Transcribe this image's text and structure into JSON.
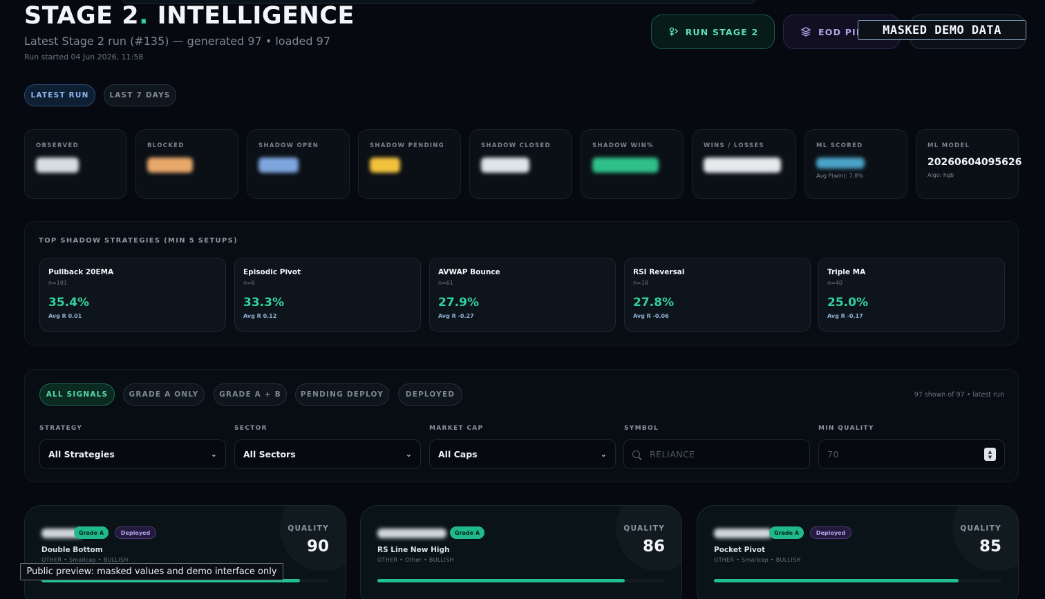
{
  "header": {
    "title_main": "STAGE 2",
    "title_dot": ".",
    "title_rest": " INTELLIGENCE",
    "subtitle": "Latest Stage 2 run (#135) — generated 97 • loaded 97",
    "run_started": "Run started 04 Jun 2026, 11:58"
  },
  "actions": {
    "run_stage2": "RUN STAGE 2",
    "eod_pipeline": "EOD PIPE",
    "masked_banner": "MASKED DEMO DATA"
  },
  "range_tabs": [
    "LATEST RUN",
    "LAST 7 DAYS"
  ],
  "stats": {
    "observed": "OBSERVED",
    "blocked": "BLOCKED",
    "shadow_open": "SHADOW OPEN",
    "shadow_pending": "SHADOW PENDING",
    "shadow_closed": "SHADOW CLOSED",
    "shadow_win": "SHADOW WIN%",
    "wins_losses": "WINS / LOSSES",
    "ml_scored": "ML SCORED",
    "ml_scored_sub": "Avg P(win): 7.8%",
    "ml_model": "ML MODEL",
    "ml_model_value": "20260604095626",
    "ml_model_sub": "Algo: hgb"
  },
  "top_strategies": {
    "title": "TOP SHADOW STRATEGIES (MIN 5 SETUPS)",
    "items": [
      {
        "name": "Pullback 20EMA",
        "n": "n=181",
        "pct": "35.4%",
        "avg": "Avg R 0.01"
      },
      {
        "name": "Episodic Pivot",
        "n": "n=6",
        "pct": "33.3%",
        "avg": "Avg R 0.12"
      },
      {
        "name": "AVWAP Bounce",
        "n": "n=61",
        "pct": "27.9%",
        "avg": "Avg R -0.27"
      },
      {
        "name": "RSI Reversal",
        "n": "n=18",
        "pct": "27.8%",
        "avg": "Avg R -0.06"
      },
      {
        "name": "Triple MA",
        "n": "n=40",
        "pct": "25.0%",
        "avg": "Avg R -0.17"
      }
    ]
  },
  "filters": {
    "pills": [
      "ALL SIGNALS",
      "GRADE A ONLY",
      "GRADE A + B",
      "PENDING DEPLOY",
      "DEPLOYED"
    ],
    "shown": "97 shown of 97 • latest run",
    "strategy_label": "STRATEGY",
    "strategy_value": "All Strategies",
    "sector_label": "SECTOR",
    "sector_value": "All Sectors",
    "cap_label": "MARKET CAP",
    "cap_value": "All Caps",
    "symbol_label": "SYMBOL",
    "symbol_placeholder": "RELIANCE",
    "quality_label": "MIN QUALITY",
    "quality_placeholder": "70"
  },
  "signals": [
    {
      "grade": "Grade A",
      "deployed": "Deployed",
      "name": "Double Bottom",
      "meta": "OTHER • Smallcap • BULLISH",
      "quality_label": "QUALITY",
      "quality": "90",
      "quality_fraction": 0.9
    },
    {
      "grade": "Grade A",
      "deployed": "",
      "name": "RS Line New High",
      "meta": "OTHER • Other • BULLISH",
      "quality_label": "QUALITY",
      "quality": "86",
      "quality_fraction": 0.86
    },
    {
      "grade": "Grade A",
      "deployed": "Deployed",
      "name": "Pocket Pivot",
      "meta": "OTHER • Smallcap • BULLISH",
      "quality_label": "QUALITY",
      "quality": "85",
      "quality_fraction": 0.85
    }
  ],
  "preview_note": "Public preview: masked values and demo interface only",
  "colors": {
    "accent": "#2fcf95",
    "background": "#060a10",
    "deployed": "#b9a6f2"
  }
}
